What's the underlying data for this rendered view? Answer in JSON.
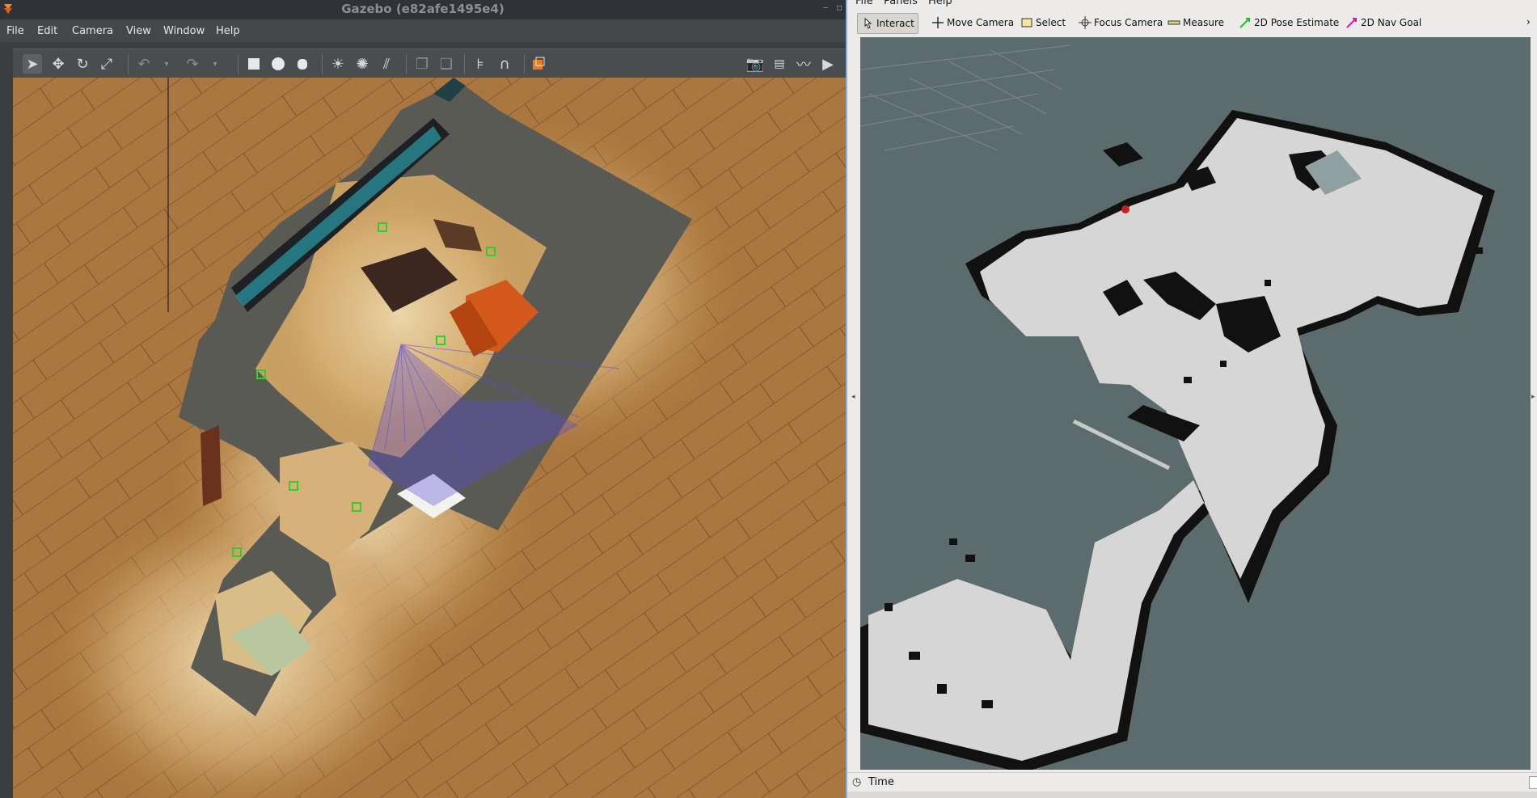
{
  "gazebo": {
    "title": "Gazebo (e82afe1495e4)",
    "menus": [
      "File",
      "Edit",
      "Camera",
      "View",
      "Window",
      "Help"
    ],
    "toolbar_icons": [
      "select-arrow-icon",
      "translate-icon",
      "rotate-icon",
      "scale-icon",
      "undo-icon",
      "undo-dropdown-icon",
      "redo-icon",
      "redo-dropdown-icon",
      "box-shape-icon",
      "sphere-shape-icon",
      "cylinder-shape-icon",
      "point-light-icon",
      "spot-light-icon",
      "directional-light-icon",
      "copy-icon",
      "paste-icon",
      "align-icon",
      "snap-magnet-icon",
      "view-angle-icon",
      "screenshot-icon",
      "log-icon",
      "plot-icon",
      "record-video-icon"
    ]
  },
  "rviz": {
    "menus": [
      "File",
      "Panels",
      "Help"
    ],
    "tools": [
      {
        "label": "Interact",
        "icon": "cursor-hand-icon"
      },
      {
        "label": "Move Camera",
        "icon": "move-camera-icon"
      },
      {
        "label": "Select",
        "icon": "select-rect-icon"
      },
      {
        "label": "Focus Camera",
        "icon": "focus-camera-icon"
      },
      {
        "label": "Measure",
        "icon": "ruler-icon"
      },
      {
        "label": "2D Pose Estimate",
        "icon": "green-arrow-icon"
      },
      {
        "label": "2D Nav Goal",
        "icon": "magenta-arrow-icon"
      }
    ],
    "time_label": "Time"
  },
  "colors": {
    "map_free": "#d6d6d6",
    "map_wall": "#111111",
    "map_unknown": "#5c6b6b",
    "floor_wood": "#b8864a",
    "laser": "#5b4bd8"
  }
}
